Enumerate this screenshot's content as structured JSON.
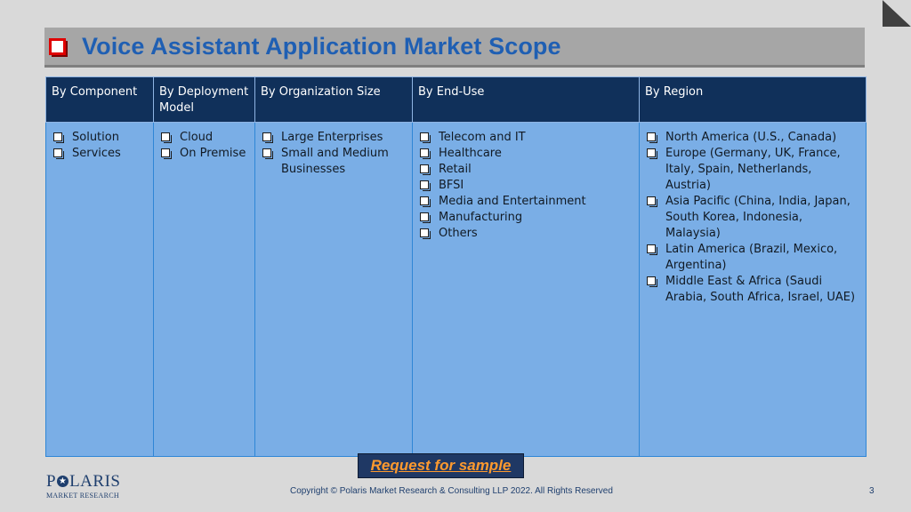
{
  "slide": {
    "title": "Voice Assistant Application Market Scope",
    "page_number": "3",
    "copyright": "Copyright © Polaris Market Research & Consulting LLP 2022. All Rights Reserved"
  },
  "table": {
    "columns": [
      {
        "header": "By Component",
        "items": [
          "Solution",
          "Services"
        ]
      },
      {
        "header": "By Deployment Model",
        "items": [
          "Cloud",
          "On Premise"
        ]
      },
      {
        "header": "By Organization Size",
        "items": [
          "Large Enterprises",
          "Small and Medium Businesses"
        ]
      },
      {
        "header": "By End-Use",
        "items": [
          "Telecom and IT",
          "Healthcare",
          "Retail",
          "BFSI",
          "Media and Entertainment",
          "Manufacturing",
          "Others"
        ]
      },
      {
        "header": "By Region",
        "items": [
          "North America (U.S., Canada)",
          "Europe (Germany, UK, France, Italy, Spain, Netherlands, Austria)",
          "Asia Pacific (China, India, Japan, South Korea, Indonesia, Malaysia)",
          "Latin America (Brazil, Mexico, Argentina)",
          "Middle East & Africa (Saudi Arabia, South Africa, Israel, UAE)"
        ]
      }
    ]
  },
  "cta": {
    "label": "Request for sample"
  },
  "logo": {
    "main_before": "P",
    "main_after": "LARIS",
    "sub": "MARKET RESEARCH"
  },
  "icons": {
    "bullet": "checkbox-bullet-icon",
    "title_bullet": "checkbox-bullet-icon",
    "corner": "page-corner-fold-icon"
  },
  "colors": {
    "title": "#1f5fb3",
    "header_bg": "#10305a",
    "cell_bg": "#7aaee6",
    "cta_text": "#ff9a2e",
    "cta_bg": "#1f3864"
  }
}
